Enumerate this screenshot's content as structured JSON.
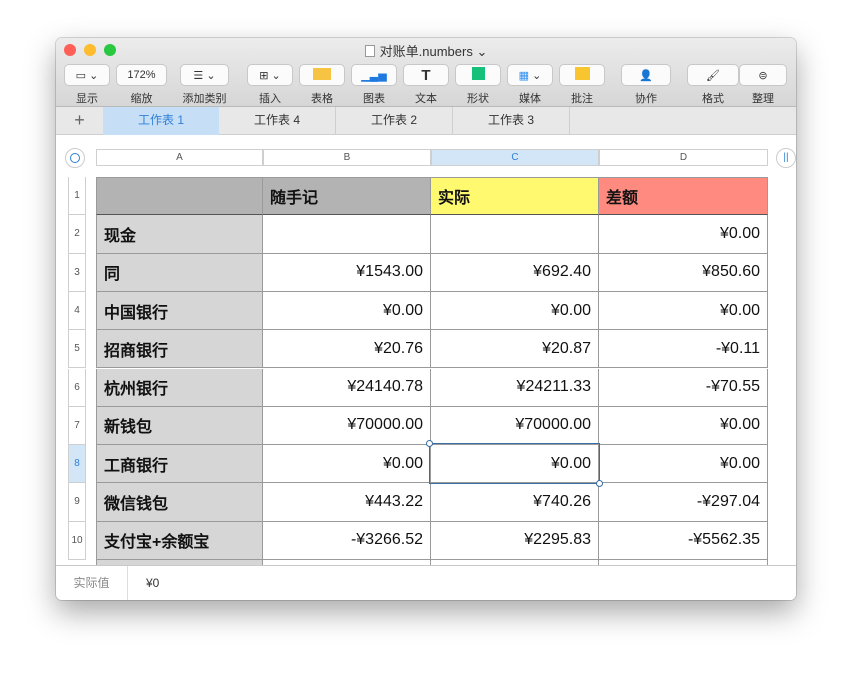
{
  "window": {
    "title": "对账单.numbers"
  },
  "colors": {
    "accent": "#2f7fd6",
    "header_gray": "#b3b3b3",
    "yellow": "#fff970",
    "red": "#ff8a80",
    "label_gray": "#d6d6d6"
  },
  "toolbar": [
    {
      "label": "显示",
      "icon": "view-icon"
    },
    {
      "label": "缩放",
      "value": "172%",
      "icon": "zoom-select"
    },
    {
      "label": "添加类别",
      "icon": "list-icon"
    },
    {
      "label": "插入",
      "icon": "insert-icon"
    },
    {
      "label": "表格",
      "icon": "table-icon"
    },
    {
      "label": "图表",
      "icon": "chart-icon"
    },
    {
      "label": "文本",
      "icon": "text-icon"
    },
    {
      "label": "形状",
      "icon": "shape-icon"
    },
    {
      "label": "媒体",
      "icon": "media-icon"
    },
    {
      "label": "批注",
      "icon": "comment-icon"
    },
    {
      "label": "协作",
      "icon": "collaborate-icon"
    },
    {
      "label": "格式",
      "icon": "format-brush-icon"
    },
    {
      "label": "整理",
      "icon": "organize-icon"
    }
  ],
  "tabs": {
    "add": "+",
    "items": [
      "工作表 1",
      "工作表 4",
      "工作表 2",
      "工作表 3"
    ]
  },
  "columns": [
    "A",
    "B",
    "C",
    "D"
  ],
  "header": [
    "",
    "随手记",
    "实际",
    "差额"
  ],
  "rows": [
    [
      "现金",
      "",
      "",
      "¥0.00"
    ],
    [
      "同",
      "¥1543.00",
      "¥692.40",
      "¥850.60"
    ],
    [
      "中国银行",
      "¥0.00",
      "¥0.00",
      "¥0.00"
    ],
    [
      "招商银行",
      "¥20.76",
      "¥20.87",
      "-¥0.11"
    ],
    [
      "杭州银行",
      "¥24140.78",
      "¥24211.33",
      "-¥70.55"
    ],
    [
      "新钱包",
      "¥70000.00",
      "¥70000.00",
      "¥0.00"
    ],
    [
      "工商银行",
      "¥0.00",
      "¥0.00",
      "¥0.00"
    ],
    [
      "微信钱包",
      "¥443.22",
      "¥740.26",
      "-¥297.04"
    ],
    [
      "支付宝+余额宝",
      "-¥3266.52",
      "¥2295.83",
      "-¥5562.35"
    ],
    [
      "",
      "",
      "",
      ""
    ]
  ],
  "row_numbers": [
    "1",
    "2",
    "3",
    "4",
    "5",
    "6",
    "7",
    "8",
    "9",
    "10"
  ],
  "selected": {
    "row": "8",
    "column": "C"
  },
  "footer": {
    "label": "实际值",
    "value": "¥0"
  }
}
